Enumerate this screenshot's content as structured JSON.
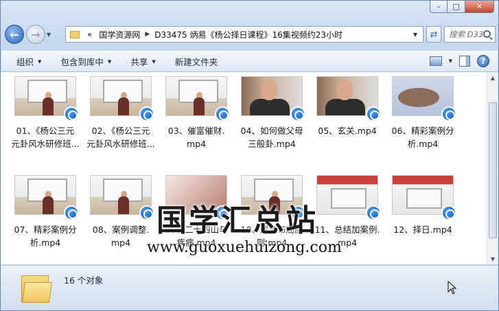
{
  "window": {
    "caption_buttons": {
      "minimize": "–",
      "maximize": "□",
      "close": "✕"
    }
  },
  "nav": {
    "back_icon": "back-arrow-icon",
    "forward_icon": "forward-arrow-icon",
    "chevron": "«",
    "breadcrumbs": [
      "国学资源网",
      "D33475 炳易《杨公择日课程》16集视频约23小时"
    ],
    "search_placeholder": "搜索 D33..."
  },
  "toolbar": {
    "organize": "组织",
    "include_in_library": "包含到库中",
    "share": "共享",
    "new_folder": "新建文件夹"
  },
  "files": [
    {
      "line1": "01、《杨公三元",
      "line2": "元卦风水研修班...",
      "thumb": "class"
    },
    {
      "line1": "02、《杨公三元",
      "line2": "元卦风水研修班...",
      "thumb": "class"
    },
    {
      "line1": "03、催富催财.",
      "line2": "mp4",
      "thumb": "class"
    },
    {
      "line1": "04、如何做父母",
      "line2": "三般卦.mp4",
      "thumb": "close"
    },
    {
      "line1": "05、玄关.mp4",
      "line2": "",
      "thumb": "close"
    },
    {
      "line1": "06、精彩案例分",
      "line2": "析.mp4",
      "thumb": "hand"
    },
    {
      "line1": "07、精彩案例分",
      "line2": "析.mp4",
      "thumb": "class"
    },
    {
      "line1": "08、案例调整.",
      "line2": "mp4",
      "thumb": "class"
    },
    {
      "line1": "09、二十四山与",
      "line2": "疾病.mp4",
      "thumb": "blur"
    },
    {
      "line1": "10、居家布局原",
      "line2": "则.mp4",
      "thumb": "class"
    },
    {
      "line1": "11、总结加案例.",
      "line2": "mp4",
      "thumb": "red"
    },
    {
      "line1": "12、择日.mp4",
      "line2": "",
      "thumb": "red"
    }
  ],
  "watermark": {
    "title": "国学汇总站",
    "url": "www.guoxuehuizong.com"
  },
  "status": {
    "count": "16 个对象"
  }
}
